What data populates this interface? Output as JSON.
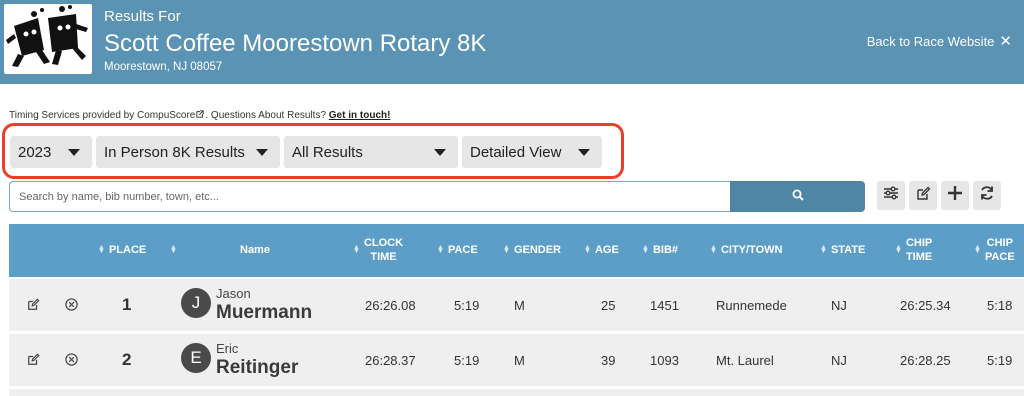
{
  "header": {
    "subtitle": "Results For",
    "title": "Scott Coffee Moorestown Rotary 8K",
    "location": "Moorestown, NJ 08057",
    "back_link": "Back to Race Website",
    "back_icon": "close-icon"
  },
  "timing": {
    "prefix": "Timing Services provided by CompuScore",
    "question": ". Questions About Results? ",
    "link": "Get in touch!"
  },
  "filters": {
    "year": "2023",
    "race": "In Person 8K Results",
    "results": "All Results",
    "view": "Detailed View",
    "highlight_color": "#e64028"
  },
  "search": {
    "placeholder": "Search by name, bib number, town, etc...",
    "button_icon": "search-icon"
  },
  "tools": [
    "sliders-icon",
    "edit-icon",
    "plus-icon",
    "refresh-icon"
  ],
  "table": {
    "header_color": "#5d9ec8",
    "columns": {
      "place": "PLACE",
      "name": "Name",
      "clock_time_1": "CLOCK",
      "clock_time_2": "TIME",
      "pace": "PACE",
      "gender": "GENDER",
      "age": "AGE",
      "bib": "BIB#",
      "city": "CITY/TOWN",
      "state": "STATE",
      "chip_time_1": "CHIP",
      "chip_time_2": "TIME",
      "chip_pace_1": "CHIP",
      "chip_pace_2": "PACE"
    },
    "rows": [
      {
        "place": "1",
        "initial": "J",
        "first": "Jason",
        "last": "Muermann",
        "clock": "26:26.08",
        "pace": "5:19",
        "gender": "M",
        "age": "25",
        "bib": "1451",
        "city": "Runnemede",
        "state": "NJ",
        "chip_time": "26:25.34",
        "chip_pace": "5:18"
      },
      {
        "place": "2",
        "initial": "E",
        "first": "Eric",
        "last": "Reitinger",
        "clock": "26:28.37",
        "pace": "5:19",
        "gender": "M",
        "age": "39",
        "bib": "1093",
        "city": "Mt. Laurel",
        "state": "NJ",
        "chip_time": "26:28.25",
        "chip_pace": "5:19"
      }
    ]
  }
}
